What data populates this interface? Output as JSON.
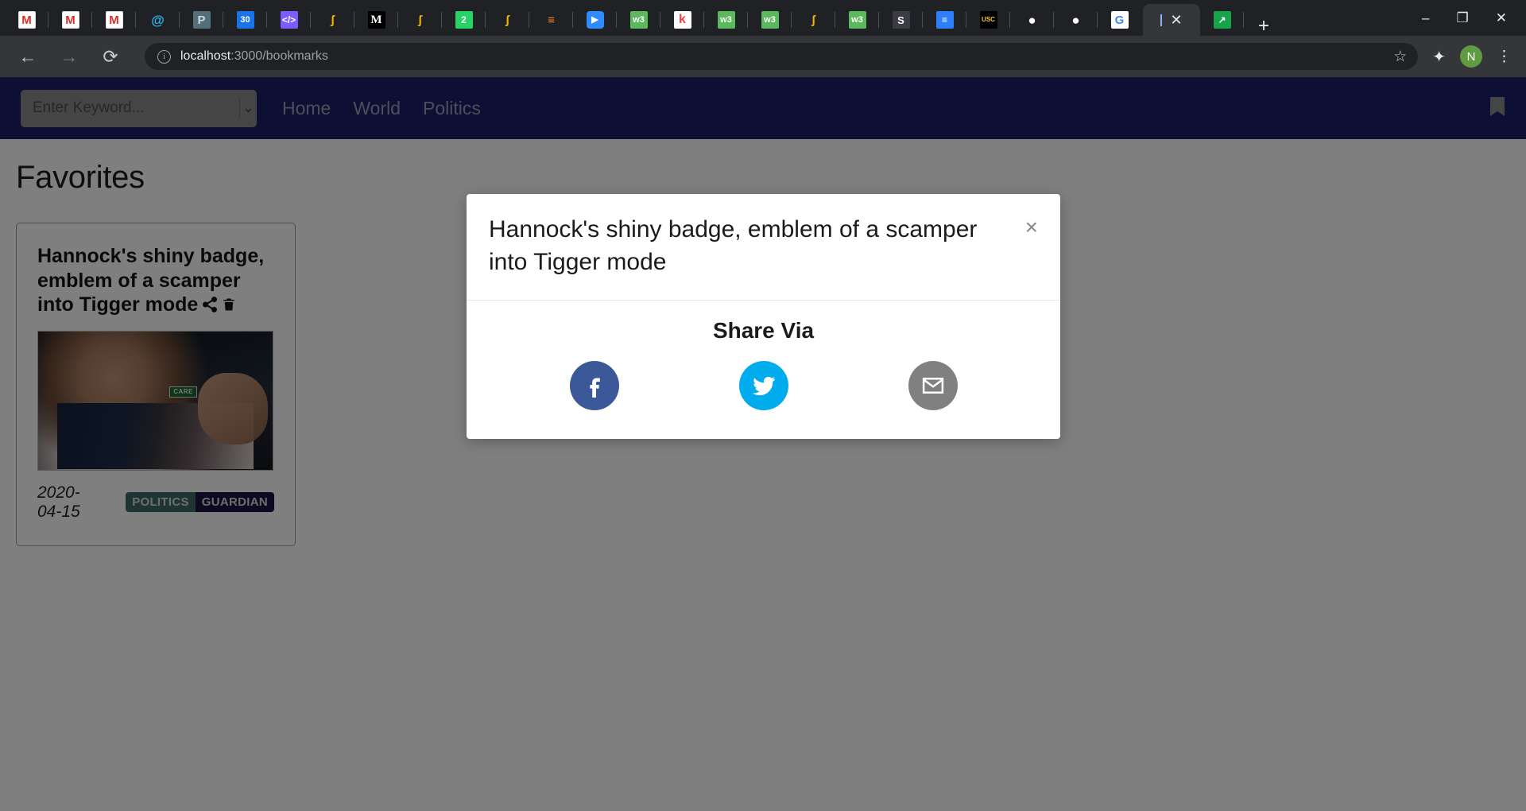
{
  "browser": {
    "pinned_tabs": [
      {
        "name": "gmail-tab-1",
        "glyph": "M",
        "cls": "fi-gmail"
      },
      {
        "name": "gmail-tab-2",
        "glyph": "M",
        "cls": "fi-gmail"
      },
      {
        "name": "gmail-tab-3",
        "glyph": "M",
        "cls": "fi-gmail"
      },
      {
        "name": "outlook-tab",
        "glyph": "@",
        "cls": "fi-at"
      },
      {
        "name": "postman-tab",
        "glyph": "P",
        "cls": "fi-p"
      },
      {
        "name": "calendar-tab",
        "glyph": "30",
        "cls": "fi-cal"
      },
      {
        "name": "codepen-tab",
        "glyph": "</>",
        "cls": "fi-code"
      },
      {
        "name": "javascript-tab-1",
        "glyph": "ʃ",
        "cls": "fi-js"
      },
      {
        "name": "medium-tab",
        "glyph": "M",
        "cls": "fi-m"
      },
      {
        "name": "javascript-tab-2",
        "glyph": "ʃ",
        "cls": "fi-js"
      },
      {
        "name": "whatsapp-tab",
        "glyph": "2",
        "cls": "fi-wa"
      },
      {
        "name": "javascript-tab-3",
        "glyph": "ʃ",
        "cls": "fi-js"
      },
      {
        "name": "stackoverflow-tab",
        "glyph": "≡",
        "cls": "fi-so"
      },
      {
        "name": "zoom-tab",
        "glyph": "▶",
        "cls": "fi-zoom"
      },
      {
        "name": "w3schools-tab-1",
        "glyph": "w3",
        "cls": "fi-w3"
      },
      {
        "name": "kotlin-tab",
        "glyph": "k",
        "cls": "fi-k"
      },
      {
        "name": "w3schools-tab-2",
        "glyph": "w3",
        "cls": "fi-w3"
      },
      {
        "name": "w3schools-tab-3",
        "glyph": "w3",
        "cls": "fi-w3"
      },
      {
        "name": "javascript-tab-4",
        "glyph": "ʃ",
        "cls": "fi-js"
      },
      {
        "name": "w3schools-tab-4",
        "glyph": "w3",
        "cls": "fi-w3"
      },
      {
        "name": "sitepoint-tab",
        "glyph": "S",
        "cls": "fi-s"
      },
      {
        "name": "docs-tab",
        "glyph": "≡",
        "cls": "fi-doc"
      },
      {
        "name": "usc-tab",
        "glyph": "USC",
        "cls": "fi-usc"
      },
      {
        "name": "github-tab-1",
        "glyph": "●",
        "cls": "fi-gh"
      },
      {
        "name": "github-tab-2",
        "glyph": "●",
        "cls": "fi-gh"
      },
      {
        "name": "google-tab",
        "glyph": "G",
        "cls": "fi-goog"
      }
    ],
    "active_tab": {
      "close_label": "✕"
    },
    "after_active_tab": {
      "name": "excel-tab",
      "glyph": "↗",
      "cls": "fi-green"
    },
    "new_tab_label": "+",
    "window_controls": {
      "minimize": "–",
      "maximize": "❐",
      "close": "✕"
    },
    "toolbar": {
      "back": "←",
      "forward": "→",
      "reload": "⟳",
      "info_icon": "i",
      "url_host": "localhost",
      "url_path": ":3000/bookmarks",
      "star": "☆",
      "extensions": "✦",
      "profile_initial": "N",
      "menu": "⋮"
    }
  },
  "site": {
    "search": {
      "placeholder": "Enter Keyword...",
      "value": "",
      "caret": "⌄"
    },
    "nav_links": [
      {
        "label": "Home"
      },
      {
        "label": "World"
      },
      {
        "label": "Politics"
      }
    ],
    "bookmark_icon": "bookmark-icon"
  },
  "page": {
    "title": "Favorites"
  },
  "card": {
    "title": "Hannock's shiny badge, emblem of a scamper into Tigger mode",
    "share_icon": "share-icon",
    "delete_icon": "trash-icon",
    "thumbnail_badge_text": "CARE",
    "date": "2020-04-15",
    "tags": [
      {
        "label": "POLITICS",
        "color": "#3f6a69"
      },
      {
        "label": "GUARDIAN",
        "color": "#1a1340"
      }
    ]
  },
  "modal": {
    "title": "Hannock's shiny badge, emblem of a scamper into Tigger mode",
    "close_label": "×",
    "share_heading": "Share Via",
    "share_buttons": [
      {
        "name": "facebook-share-button",
        "glyph": "f",
        "color": "#3b5998"
      },
      {
        "name": "twitter-share-button",
        "glyph": "✉",
        "color": "#00aced"
      },
      {
        "name": "email-share-button",
        "glyph": "✉",
        "color": "#808080"
      }
    ]
  },
  "colors": {
    "navbar": "#1b1f68",
    "overlay": "rgba(0,0,0,.5)",
    "accent_facebook": "#3b5998",
    "accent_twitter": "#00aced",
    "accent_email": "#808080"
  }
}
